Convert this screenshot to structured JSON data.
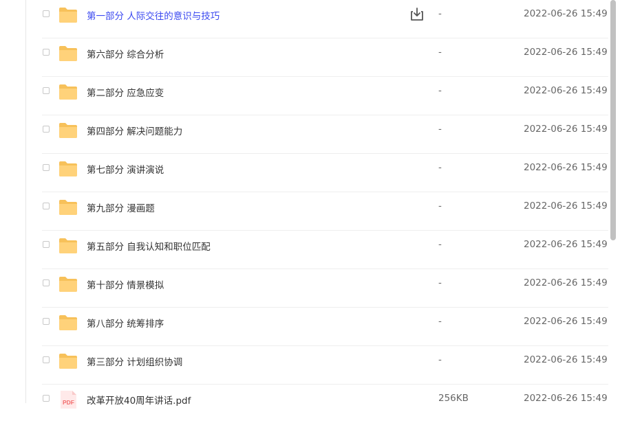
{
  "files": [
    {
      "name": "第一部分 人际交往的意识与技巧",
      "size": "-",
      "date": "2022-06-26 15:49",
      "type": "folder",
      "hovered": true
    },
    {
      "name": "第六部分 综合分析",
      "size": "-",
      "date": "2022-06-26 15:49",
      "type": "folder"
    },
    {
      "name": "第二部分 应急应变",
      "size": "-",
      "date": "2022-06-26 15:49",
      "type": "folder"
    },
    {
      "name": "第四部分 解决问题能力",
      "size": "-",
      "date": "2022-06-26 15:49",
      "type": "folder"
    },
    {
      "name": "第七部分 演讲演说",
      "size": "-",
      "date": "2022-06-26 15:49",
      "type": "folder"
    },
    {
      "name": "第九部分 漫画题",
      "size": "-",
      "date": "2022-06-26 15:49",
      "type": "folder"
    },
    {
      "name": "第五部分 自我认知和职位匹配",
      "size": "-",
      "date": "2022-06-26 15:49",
      "type": "folder"
    },
    {
      "name": "第十部分 情景模拟",
      "size": "-",
      "date": "2022-06-26 15:49",
      "type": "folder"
    },
    {
      "name": "第八部分 统筹排序",
      "size": "-",
      "date": "2022-06-26 15:49",
      "type": "folder"
    },
    {
      "name": "第三部分 计划组织协调",
      "size": "-",
      "date": "2022-06-26 15:49",
      "type": "folder"
    },
    {
      "name": "改革开放40周年讲话.pdf",
      "size": "256KB",
      "date": "2022-06-26 15:49",
      "type": "pdf",
      "icon_text": "PDF"
    }
  ],
  "colors": {
    "folder": "#ffd27a",
    "folder_dark": "#f7c15a",
    "link": "#3b49f0",
    "pdf_bg": "#ffe9e9",
    "pdf_text": "#f26d6d"
  },
  "icons": {
    "folder": "folder-icon",
    "pdf": "pdf-file-icon",
    "download": "download-icon"
  }
}
